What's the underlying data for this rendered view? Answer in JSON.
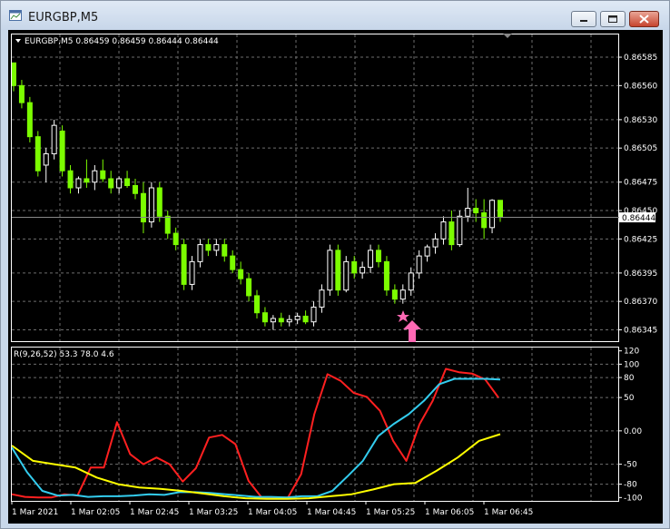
{
  "window": {
    "title": "EURGBP,M5"
  },
  "chart_data": [
    {
      "type": "candlestick",
      "header": "EURGBP,M5  0.86459 0.86459 0.86444 0.86444",
      "ylim": [
        0.86335,
        0.86605
      ],
      "price_ticks": [
        "0.86585",
        "0.86560",
        "0.86530",
        "0.86505",
        "0.86475",
        "0.86450",
        "0.86425",
        "0.86395",
        "0.86370",
        "0.86345"
      ],
      "current_price": "0.86444",
      "current_price_value": 0.86444,
      "colors": {
        "bull": "#ffffff",
        "bear": "#7cfc00",
        "grid": "#6e6e6e",
        "marker": "#ff69b4"
      },
      "markers": [
        "star-icon",
        "arrow-up-icon"
      ],
      "candles": [
        [
          0.8658,
          0.8658,
          0.86555,
          0.8656
        ],
        [
          0.8656,
          0.86565,
          0.8654,
          0.86545
        ],
        [
          0.86545,
          0.8655,
          0.8651,
          0.86515
        ],
        [
          0.86515,
          0.8652,
          0.8648,
          0.86485
        ],
        [
          0.8649,
          0.86505,
          0.86475,
          0.865
        ],
        [
          0.865,
          0.8653,
          0.86495,
          0.86525
        ],
        [
          0.8652,
          0.86525,
          0.8648,
          0.86485
        ],
        [
          0.86485,
          0.8649,
          0.86465,
          0.8647
        ],
        [
          0.8647,
          0.8648,
          0.86465,
          0.86478
        ],
        [
          0.86478,
          0.86495,
          0.8647,
          0.86475
        ],
        [
          0.86475,
          0.8649,
          0.86468,
          0.86485
        ],
        [
          0.86485,
          0.86495,
          0.86475,
          0.86478
        ],
        [
          0.86478,
          0.86485,
          0.86465,
          0.8647
        ],
        [
          0.8647,
          0.8648,
          0.86465,
          0.86478
        ],
        [
          0.86478,
          0.86485,
          0.8647,
          0.86472
        ],
        [
          0.86472,
          0.86478,
          0.8646,
          0.86465
        ],
        [
          0.86465,
          0.86475,
          0.8643,
          0.8644
        ],
        [
          0.8644,
          0.86475,
          0.86435,
          0.8647
        ],
        [
          0.8647,
          0.86475,
          0.8644,
          0.86445
        ],
        [
          0.86445,
          0.8645,
          0.86425,
          0.8643
        ],
        [
          0.8643,
          0.86435,
          0.86415,
          0.8642
        ],
        [
          0.8642,
          0.86425,
          0.8638,
          0.86385
        ],
        [
          0.86385,
          0.8641,
          0.8638,
          0.86405
        ],
        [
          0.86405,
          0.86425,
          0.864,
          0.8642
        ],
        [
          0.8642,
          0.86425,
          0.8641,
          0.86415
        ],
        [
          0.86415,
          0.86425,
          0.8641,
          0.8642
        ],
        [
          0.8642,
          0.86425,
          0.86405,
          0.8641
        ],
        [
          0.8641,
          0.86415,
          0.86395,
          0.86398
        ],
        [
          0.86398,
          0.86405,
          0.86385,
          0.8639
        ],
        [
          0.8639,
          0.86395,
          0.8637,
          0.86375
        ],
        [
          0.86375,
          0.8638,
          0.86355,
          0.8636
        ],
        [
          0.8636,
          0.86365,
          0.86348,
          0.86352
        ],
        [
          0.86352,
          0.86358,
          0.86345,
          0.86355
        ],
        [
          0.86355,
          0.8636,
          0.86348,
          0.86352
        ],
        [
          0.86352,
          0.86358,
          0.86348,
          0.86354
        ],
        [
          0.86354,
          0.8636,
          0.8635,
          0.86357
        ],
        [
          0.86357,
          0.86362,
          0.8635,
          0.86352
        ],
        [
          0.86352,
          0.8637,
          0.86348,
          0.86365
        ],
        [
          0.86365,
          0.86385,
          0.8636,
          0.8638
        ],
        [
          0.8638,
          0.8642,
          0.86375,
          0.86415
        ],
        [
          0.86415,
          0.8642,
          0.86375,
          0.8638
        ],
        [
          0.8638,
          0.8641,
          0.86378,
          0.86405
        ],
        [
          0.86405,
          0.8641,
          0.8639,
          0.86395
        ],
        [
          0.86395,
          0.86405,
          0.8639,
          0.864
        ],
        [
          0.864,
          0.8642,
          0.86395,
          0.86415
        ],
        [
          0.86415,
          0.8642,
          0.864,
          0.86405
        ],
        [
          0.86405,
          0.8641,
          0.86375,
          0.8638
        ],
        [
          0.8638,
          0.86385,
          0.86368,
          0.86372
        ],
        [
          0.86372,
          0.86385,
          0.86368,
          0.8638
        ],
        [
          0.8638,
          0.864,
          0.86375,
          0.86395
        ],
        [
          0.86395,
          0.86415,
          0.8639,
          0.8641
        ],
        [
          0.8641,
          0.8642,
          0.86405,
          0.86418
        ],
        [
          0.86418,
          0.8643,
          0.86412,
          0.86425
        ],
        [
          0.86425,
          0.86445,
          0.8642,
          0.8644
        ],
        [
          0.8644,
          0.8645,
          0.86415,
          0.8642
        ],
        [
          0.8642,
          0.8645,
          0.86418,
          0.86445
        ],
        [
          0.86445,
          0.8647,
          0.8644,
          0.86452
        ],
        [
          0.86452,
          0.8646,
          0.8644,
          0.86448
        ],
        [
          0.86448,
          0.8646,
          0.86425,
          0.86435
        ],
        [
          0.86435,
          0.8646,
          0.8643,
          0.86459
        ],
        [
          0.86459,
          0.86459,
          0.8644,
          0.86444
        ]
      ]
    },
    {
      "type": "line",
      "header": "R(9,26,52) 53.3 78.0 4.6",
      "ylim": [
        -105,
        125
      ],
      "ticks": [
        "120",
        "100",
        "80",
        "50",
        "0.00",
        "-50",
        "-80",
        "-100"
      ],
      "tick_values": [
        120,
        100,
        80,
        50,
        0,
        -50,
        -80,
        -100
      ],
      "series": [
        {
          "color": "#ff2020",
          "values": [
            -95,
            -99,
            -100,
            -100,
            -95,
            -97,
            -55,
            -55,
            13,
            -35,
            -50,
            -40,
            -50,
            -76,
            -56,
            -10,
            -6,
            -20,
            -75,
            -100,
            -100,
            -100,
            -65,
            25,
            85,
            75,
            57,
            51,
            30,
            -15,
            -45,
            10,
            45,
            93,
            88,
            86,
            77,
            50
          ]
        },
        {
          "color": "#33ccee",
          "values": [
            -25,
            -62,
            -90,
            -97,
            -96,
            -99,
            -98,
            -98,
            -97,
            -95,
            -96,
            -92,
            -92,
            -93,
            -95,
            -97,
            -99,
            -99,
            -100,
            -98,
            -98,
            -90,
            -68,
            -45,
            -8,
            10,
            25,
            45,
            70,
            78,
            78,
            78,
            77
          ]
        },
        {
          "color": "#ffff00",
          "values": [
            -22,
            -45,
            -50,
            -55,
            -70,
            -80,
            -85,
            -87,
            -90,
            -94,
            -98,
            -101,
            -102,
            -102,
            -101,
            -98,
            -95,
            -88,
            -80,
            -78,
            -60,
            -40,
            -15,
            -5
          ]
        }
      ]
    }
  ],
  "time_axis": [
    "1 Mar 2021",
    "1 Mar 02:05",
    "1 Mar 02:45",
    "1 Mar 03:25",
    "1 Mar 04:05",
    "1 Mar 04:45",
    "1 Mar 05:25",
    "1 Mar 06:05",
    "1 Mar 06:45"
  ]
}
